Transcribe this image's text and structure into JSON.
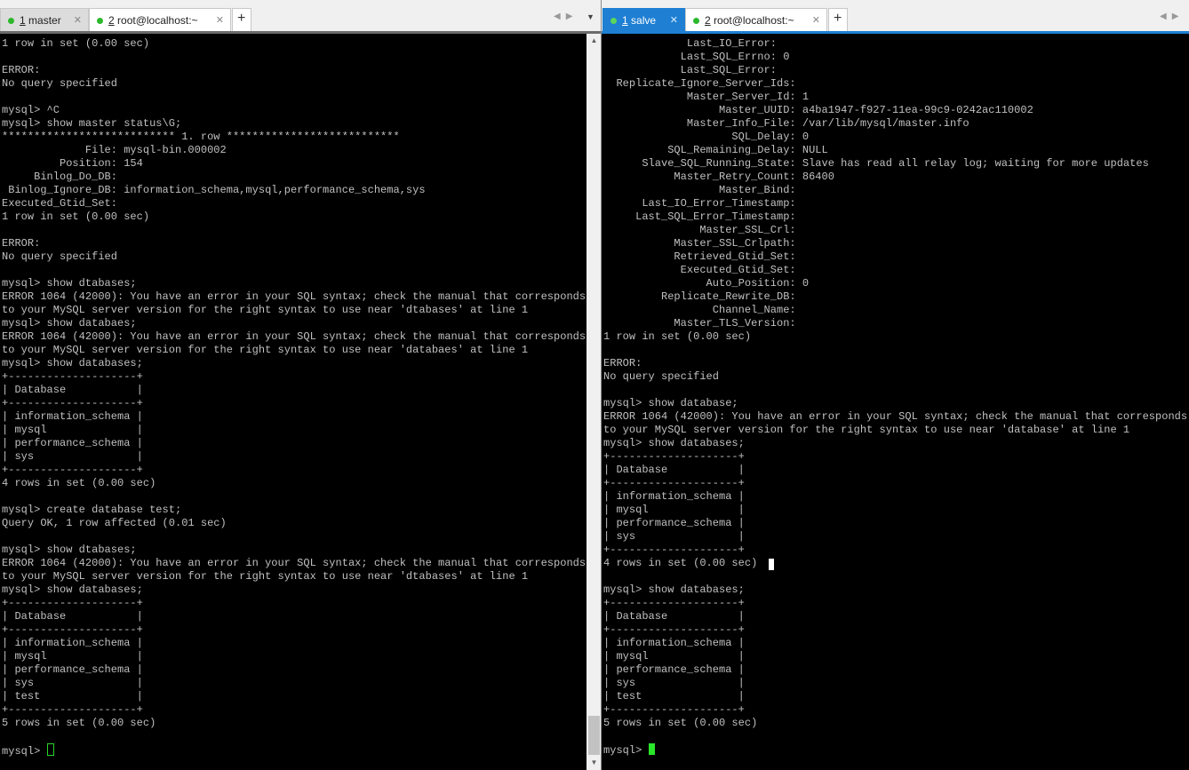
{
  "left": {
    "tabs": [
      {
        "num": "1",
        "label": " master",
        "close": "✕"
      },
      {
        "num": "2",
        "label": " root@localhost:~",
        "close": "✕"
      }
    ],
    "plus": "+",
    "nav": "◀▶",
    "dropdown": "▼",
    "accent_color": "#1e7fd3",
    "terminal_text": "1 row in set (0.00 sec)\n\nERROR:\nNo query specified\n\nmysql> ^C\nmysql> show master status\\G;\n*************************** 1. row ***************************\n             File: mysql-bin.000002\n         Position: 154\n     Binlog_Do_DB:\n Binlog_Ignore_DB: information_schema,mysql,performance_schema,sys\nExecuted_Gtid_Set:\n1 row in set (0.00 sec)\n\nERROR:\nNo query specified\n\nmysql> show dtabases;\nERROR 1064 (42000): You have an error in your SQL syntax; check the manual that corresponds\nto your MySQL server version for the right syntax to use near 'dtabases' at line 1\nmysql> show databaes;\nERROR 1064 (42000): You have an error in your SQL syntax; check the manual that corresponds\nto your MySQL server version for the right syntax to use near 'databaes' at line 1\nmysql> show databases;\n+--------------------+\n| Database           |\n+--------------------+\n| information_schema |\n| mysql              |\n| performance_schema |\n| sys                |\n+--------------------+\n4 rows in set (0.00 sec)\n\nmysql> create database test;\nQuery OK, 1 row affected (0.01 sec)\n\nmysql> show dtabases;\nERROR 1064 (42000): You have an error in your SQL syntax; check the manual that corresponds\nto your MySQL server version for the right syntax to use near 'dtabases' at line 1\nmysql> show databases;\n+--------------------+\n| Database           |\n+--------------------+\n| information_schema |\n| mysql              |\n| performance_schema |\n| sys                |\n| test               |\n+--------------------+\n5 rows in set (0.00 sec)\n\n",
    "prompt": "mysql> ",
    "scroll_up": "▲",
    "scroll_down": "▼"
  },
  "right": {
    "tabs": [
      {
        "num": "1",
        "label": " salve",
        "close": "✕"
      },
      {
        "num": "2",
        "label": " root@localhost:~",
        "close": "✕"
      }
    ],
    "plus": "+",
    "nav": "◀▶",
    "accent_color": "#1e7fd3",
    "terminal_text": "             Last_IO_Error:\n            Last_SQL_Errno: 0\n            Last_SQL_Error:\n  Replicate_Ignore_Server_Ids:\n             Master_Server_Id: 1\n                  Master_UUID: a4ba1947-f927-11ea-99c9-0242ac110002\n             Master_Info_File: /var/lib/mysql/master.info\n                    SQL_Delay: 0\n          SQL_Remaining_Delay: NULL\n      Slave_SQL_Running_State: Slave has read all relay log; waiting for more updates\n           Master_Retry_Count: 86400\n                  Master_Bind:\n      Last_IO_Error_Timestamp:\n     Last_SQL_Error_Timestamp:\n               Master_SSL_Crl:\n           Master_SSL_Crlpath:\n           Retrieved_Gtid_Set:\n            Executed_Gtid_Set:\n                Auto_Position: 0\n         Replicate_Rewrite_DB:\n                 Channel_Name:\n           Master_TLS_Version:\n1 row in set (0.00 sec)\n\nERROR:\nNo query specified\n\nmysql> show database;\nERROR 1064 (42000): You have an error in your SQL syntax; check the manual that corresponds\nto your MySQL server version for the right syntax to use near 'database' at line 1\nmysql> show databases;\n+--------------------+\n| Database           |\n+--------------------+\n| information_schema |\n| mysql              |\n| performance_schema |\n| sys                |\n+--------------------+\n4 rows in set (0.00 sec)\n\nmysql> show databases;\n+--------------------+\n| Database           |\n+--------------------+\n| information_schema |\n| mysql              |\n| performance_schema |\n| sys                |\n| test               |\n+--------------------+\n5 rows in set (0.00 sec)\n\n",
    "prompt": "mysql> "
  }
}
